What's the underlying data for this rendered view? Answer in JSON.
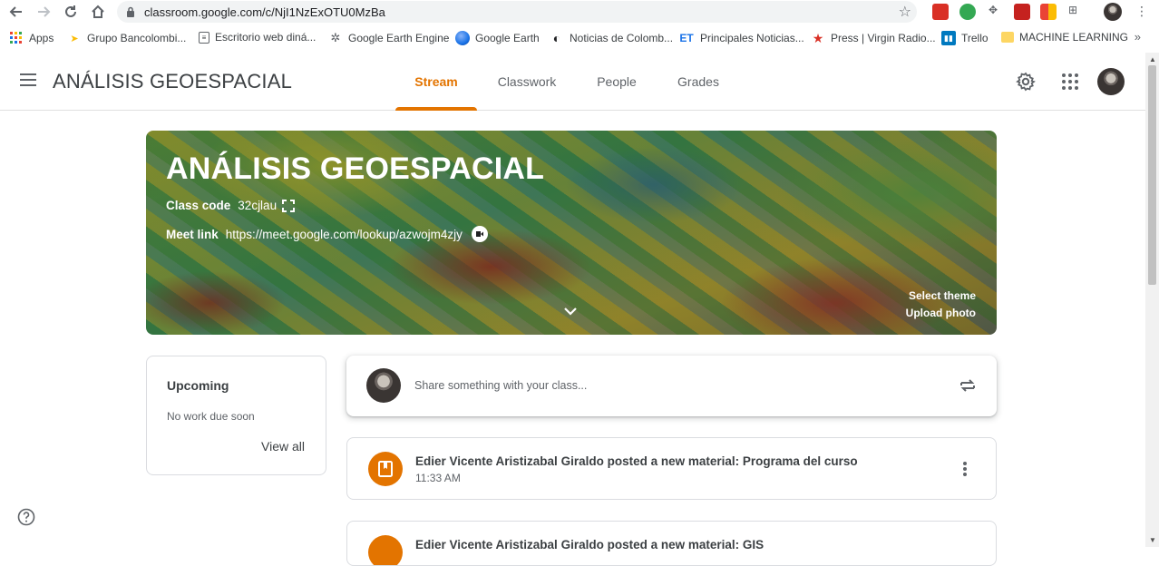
{
  "browser": {
    "url": "classroom.google.com/c/NjI1NzExOTU0MzBa",
    "bookmarks": [
      {
        "label": "Apps",
        "icon": "apps-grid-icon"
      },
      {
        "label": "Grupo Bancolombi...",
        "icon": "bancolombia-icon"
      },
      {
        "label": "Escritorio web diná...",
        "icon": "document-icon"
      },
      {
        "label": "Google Earth Engine",
        "icon": "earth-engine-icon"
      },
      {
        "label": "Google Earth",
        "icon": "google-earth-icon"
      },
      {
        "label": "Noticias de Colomb...",
        "icon": "news-icon"
      },
      {
        "label": "Principales Noticias...",
        "icon": "et-icon"
      },
      {
        "label": "Press | Virgin Radio...",
        "icon": "star-icon"
      },
      {
        "label": "Trello",
        "icon": "trello-icon"
      },
      {
        "label": "MACHINE LEARNING",
        "icon": "folder-icon"
      }
    ]
  },
  "header": {
    "class_title": "ANÁLISIS GEOESPACIAL",
    "tabs": [
      {
        "label": "Stream",
        "active": true
      },
      {
        "label": "Classwork",
        "active": false
      },
      {
        "label": "People",
        "active": false
      },
      {
        "label": "Grades",
        "active": false
      }
    ]
  },
  "banner": {
    "title": "ANÁLISIS GEOESPACIAL",
    "class_code_label": "Class code",
    "class_code": "32cjlau",
    "meet_link_label": "Meet link",
    "meet_link": "https://meet.google.com/lookup/azwojm4zjy",
    "select_theme": "Select theme",
    "upload_photo": "Upload photo"
  },
  "upcoming": {
    "title": "Upcoming",
    "empty_text": "No work due soon",
    "view_all": "View all"
  },
  "share": {
    "placeholder": "Share something with your class..."
  },
  "posts": [
    {
      "title": "Edier Vicente Aristizabal Giraldo posted a new material: Programa del curso",
      "time": "11:33 AM"
    },
    {
      "title": "Edier Vicente Aristizabal Giraldo posted a new material: GIS",
      "time": ""
    }
  ],
  "colors": {
    "accent": "#e37400",
    "text": "#3c4043",
    "muted": "#5f6368"
  }
}
